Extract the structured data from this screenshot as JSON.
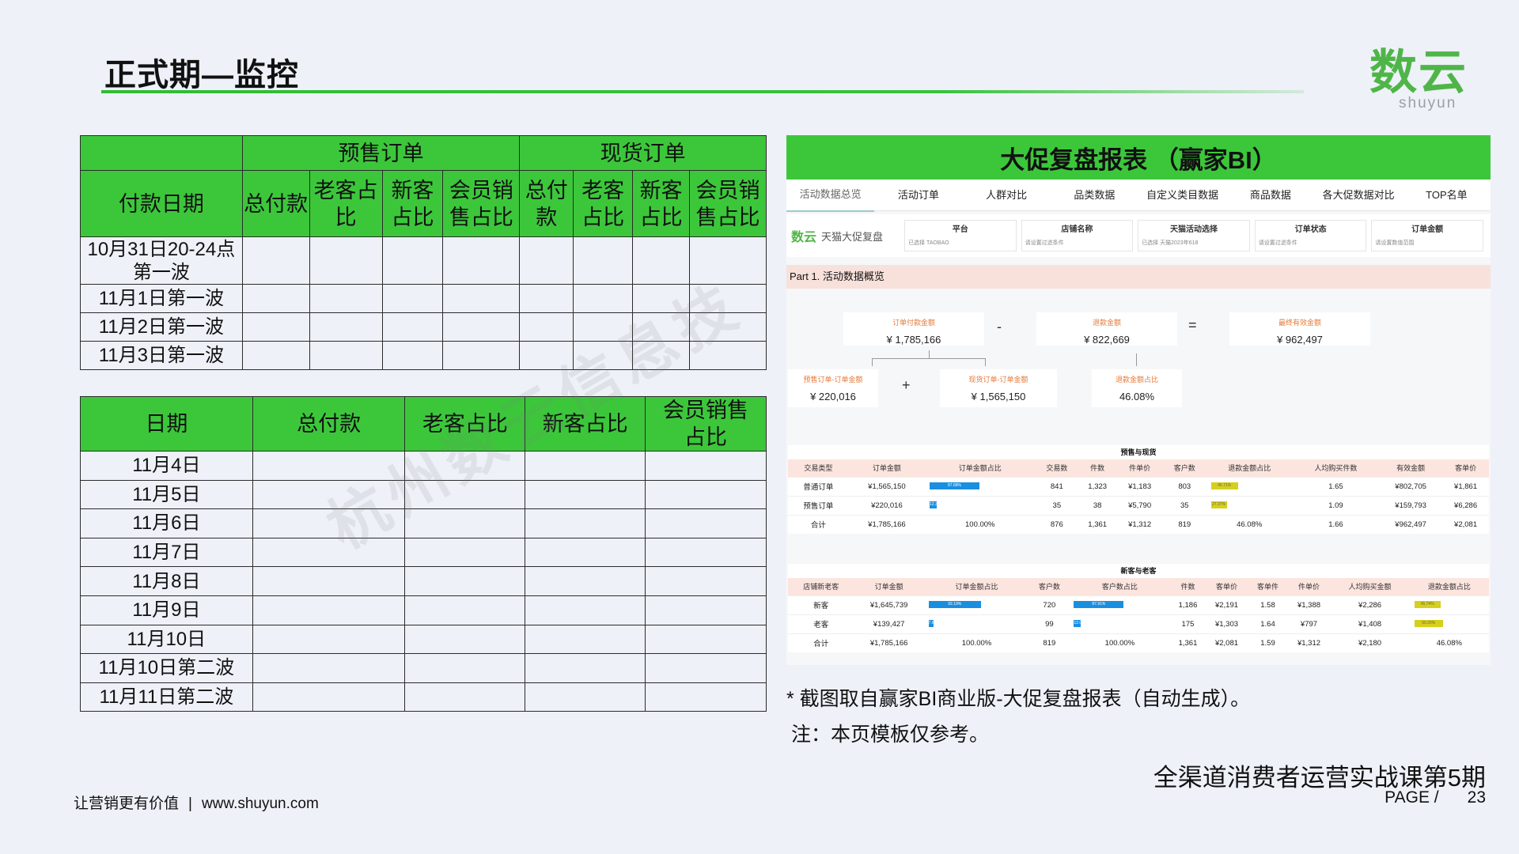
{
  "title": "正式期—监控",
  "logo": {
    "mark": "数云",
    "text": "shuyun"
  },
  "table1": {
    "group_headers": [
      "预售订单",
      "现货订单"
    ],
    "row_header": "付款日期",
    "sub_headers": [
      "总付款",
      "老客占比",
      "新客占比",
      "会员销售占比",
      "总付款",
      "老客占比",
      "新客占比",
      "会员销售占比"
    ],
    "rows": [
      "10月31日20-24点第一波",
      "11月1日第一波",
      "11月2日第一波",
      "11月3日第一波"
    ]
  },
  "table2": {
    "headers": [
      "日期",
      "总付款",
      "老客占比",
      "新客占比",
      "会员销售占比"
    ],
    "rows": [
      "11月4日",
      "11月5日",
      "11月6日",
      "11月7日",
      "11月8日",
      "11月9日",
      "11月10日",
      "11月10日第二波",
      "11月11日第二波"
    ]
  },
  "watermark": "杭州数云信息技",
  "bi": {
    "title": "大促复盘报表 （赢家BI）",
    "tabs": [
      "活动数据总览",
      "活动订单",
      "人群对比",
      "品类数据",
      "自定义类目数据",
      "商品数据",
      "各大促数据对比",
      "TOP名单"
    ],
    "logo_brand": "数云",
    "logo_text": "天猫大促复盘",
    "filters": [
      {
        "title": "平台",
        "value": "已选择 TAOBAO"
      },
      {
        "title": "店铺名称",
        "value": "请设置过滤条件"
      },
      {
        "title": "天猫活动选择",
        "value": "已选择 天猫2023年618"
      },
      {
        "title": "订单状态",
        "value": "请设置过滤条件"
      },
      {
        "title": "订单金额",
        "value": "请设置数值范围"
      }
    ],
    "part_title": "Part 1. 活动数据概览",
    "kpis": {
      "order_pay": {
        "label": "订单付款金额",
        "value": "¥ 1,785,166"
      },
      "refund": {
        "label": "退款金额",
        "value": "¥ 822,669"
      },
      "final": {
        "label": "最终有效金额",
        "value": "¥ 962,497"
      },
      "presale": {
        "label": "预售订单-订单金额",
        "value": "¥ 220,016"
      },
      "spot": {
        "label": "现货订单-订单金额",
        "value": "¥ 1,565,150"
      },
      "refund_ratio": {
        "label": "退款金额占比",
        "value": "46.08%"
      }
    },
    "operators": {
      "minus": "-",
      "equals": "=",
      "plus": "+"
    },
    "table_a": {
      "title": "预售与现货",
      "headers": [
        "交易类型",
        "订单金额",
        "订单金额占比",
        "交易数",
        "件数",
        "件单价",
        "客户数",
        "退款金额占比",
        "人均购买件数",
        "有效金额",
        "客单价"
      ],
      "rows": [
        [
          "普通订单",
          "¥1,565,150",
          "87.68%",
          "841",
          "1,323",
          "¥1,183",
          "803",
          "46.71%",
          "1.65",
          "¥802,705",
          "¥1,861"
        ],
        [
          "预售订单",
          "¥220,016",
          "12.32%",
          "35",
          "38",
          "¥5,790",
          "35",
          "27.37%",
          "1.09",
          "¥159,793",
          "¥6,286"
        ],
        [
          "合计",
          "¥1,785,166",
          "100.00%",
          "876",
          "1,361",
          "¥1,312",
          "819",
          "46.08%",
          "1.66",
          "¥962,497",
          "¥2,081"
        ]
      ],
      "bars": [
        [
          0.8768,
          0.4671
        ],
        [
          0.1232,
          0.2737
        ]
      ]
    },
    "table_b": {
      "title": "新客与老客",
      "headers": [
        "店铺新老客",
        "订单金额",
        "订单金额占比",
        "客户数",
        "客户数占比",
        "件数",
        "客单价",
        "客单件",
        "件单价",
        "人均购买金额",
        "退款金额占比"
      ],
      "rows": [
        [
          "新客",
          "¥1,645,739",
          "92.19%",
          "720",
          "87.91%",
          "1,186",
          "¥2,191",
          "1.58",
          "¥1,388",
          "¥2,286",
          "45.74%"
        ],
        [
          "老客",
          "¥139,427",
          "7.81%",
          "99",
          "12.09%",
          "175",
          "¥1,303",
          "1.64",
          "¥797",
          "¥1,408",
          "50.20%"
        ],
        [
          "合计",
          "¥1,785,166",
          "100.00%",
          "819",
          "100.00%",
          "1,361",
          "¥2,081",
          "1.59",
          "¥1,312",
          "¥2,180",
          "46.08%"
        ]
      ],
      "bars": [
        [
          0.9219,
          0.8791,
          0.4574
        ],
        [
          0.0781,
          0.1209,
          0.502
        ]
      ]
    }
  },
  "notes": {
    "line1": "* 截图取自赢家BI商业版-大促复盘报表（自动生成）。",
    "line2": "注：本页模板仅参考。"
  },
  "course": "全渠道消费者运营实战课第5期",
  "page": {
    "label": "PAGE /",
    "number": "23"
  },
  "footer": {
    "slogan": "让营销更有价值",
    "separator": "|",
    "url": "www.shuyun.com"
  }
}
